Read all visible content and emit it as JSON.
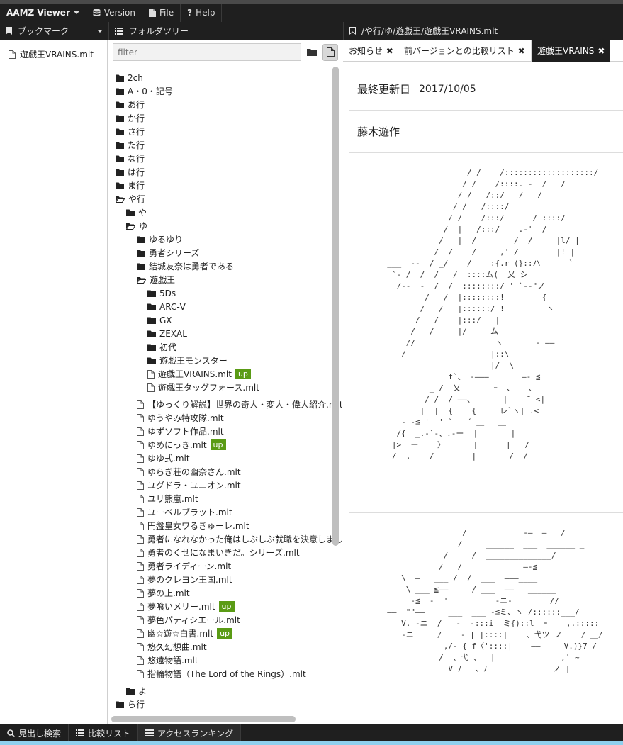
{
  "topbar": {
    "brand": "AAMZ Viewer",
    "menus": [
      {
        "label": "Version",
        "icon": "database-icon"
      },
      {
        "label": "File",
        "icon": "file-icon"
      },
      {
        "label": "Help",
        "icon": "question-icon"
      }
    ]
  },
  "bookmarks": {
    "title": "ブックマーク",
    "items": [
      "遊戯王VRAINS.mlt"
    ]
  },
  "folder_tree": {
    "title": "フォルダツリー",
    "filter_placeholder": "filter",
    "rows": [
      {
        "label": "2ch",
        "type": "folder",
        "depth": 0
      },
      {
        "label": "A・0・記号",
        "type": "folder",
        "depth": 0
      },
      {
        "label": "あ行",
        "type": "folder",
        "depth": 0
      },
      {
        "label": "か行",
        "type": "folder",
        "depth": 0
      },
      {
        "label": "さ行",
        "type": "folder",
        "depth": 0
      },
      {
        "label": "た行",
        "type": "folder",
        "depth": 0
      },
      {
        "label": "な行",
        "type": "folder",
        "depth": 0
      },
      {
        "label": "は行",
        "type": "folder",
        "depth": 0
      },
      {
        "label": "ま行",
        "type": "folder",
        "depth": 0
      },
      {
        "label": "や行",
        "type": "folder-open",
        "depth": 0
      },
      {
        "label": "や",
        "type": "folder",
        "depth": 1
      },
      {
        "label": "ゆ",
        "type": "folder-open",
        "depth": 1
      },
      {
        "label": "ゆるゆり",
        "type": "folder",
        "depth": 2
      },
      {
        "label": "勇者シリーズ",
        "type": "folder",
        "depth": 2
      },
      {
        "label": "結城友奈は勇者である",
        "type": "folder",
        "depth": 2
      },
      {
        "label": "遊戯王",
        "type": "folder-open",
        "depth": 2
      },
      {
        "label": "5Ds",
        "type": "folder",
        "depth": 3
      },
      {
        "label": "ARC-Ⅴ",
        "type": "folder",
        "depth": 3
      },
      {
        "label": "GX",
        "type": "folder",
        "depth": 3
      },
      {
        "label": "ZEXAL",
        "type": "folder",
        "depth": 3
      },
      {
        "label": "初代",
        "type": "folder",
        "depth": 3
      },
      {
        "label": "遊戯王モンスター",
        "type": "folder",
        "depth": 3
      },
      {
        "label": "遊戯王VRAINS.mlt",
        "type": "file",
        "depth": 3,
        "up": true
      },
      {
        "label": "遊戯王タッグフォース.mlt",
        "type": "file",
        "depth": 3
      },
      {
        "label": "【ゆっくり解説】世界の奇人・変人・偉人紹介.mlt",
        "type": "file",
        "depth": 2
      },
      {
        "label": "ゆうやみ特攻隊.mlt",
        "type": "file",
        "depth": 2
      },
      {
        "label": "ゆずソフト作品.mlt",
        "type": "file",
        "depth": 2
      },
      {
        "label": "ゆめにっき.mlt",
        "type": "file",
        "depth": 2,
        "up": true
      },
      {
        "label": "ゆゆ式.mlt",
        "type": "file",
        "depth": 2
      },
      {
        "label": "ゆらぎ荘の幽奈さん.mlt",
        "type": "file",
        "depth": 2
      },
      {
        "label": "ユグドラ・ユニオン.mlt",
        "type": "file",
        "depth": 2
      },
      {
        "label": "ユリ熊嵐.mlt",
        "type": "file",
        "depth": 2
      },
      {
        "label": "ユーベルブラット.mlt",
        "type": "file",
        "depth": 2
      },
      {
        "label": "円盤皇女ワるきゅーレ.mlt",
        "type": "file",
        "depth": 2
      },
      {
        "label": "勇者になれなかった俺はしぶしぶ就職を決意しました.mlt",
        "type": "file",
        "depth": 2
      },
      {
        "label": "勇者のくせになまいきだ。シリーズ.mlt",
        "type": "file",
        "depth": 2
      },
      {
        "label": "勇者ライディーン.mlt",
        "type": "file",
        "depth": 2
      },
      {
        "label": "夢のクレヨン王国.mlt",
        "type": "file",
        "depth": 2
      },
      {
        "label": "夢の上.mlt",
        "type": "file",
        "depth": 2
      },
      {
        "label": "夢喰いメリー.mlt",
        "type": "file",
        "depth": 2,
        "up": true
      },
      {
        "label": "夢色パティシエール.mlt",
        "type": "file",
        "depth": 2
      },
      {
        "label": "幽☆遊☆白書.mlt",
        "type": "file",
        "depth": 2,
        "up": true
      },
      {
        "label": "悠久幻想曲.mlt",
        "type": "file",
        "depth": 2
      },
      {
        "label": "悠遠物語.mlt",
        "type": "file",
        "depth": 2
      },
      {
        "label": "指輪物語（The Lord of the Rings）.mlt",
        "type": "file",
        "depth": 2
      },
      {
        "label": "よ",
        "type": "folder",
        "depth": 1
      },
      {
        "label": "ら行",
        "type": "folder",
        "depth": 0
      }
    ],
    "up_label": "up"
  },
  "content": {
    "path": "/や行/ゆ/遊戯王/遊戯王VRAINS.mlt",
    "tabs": [
      {
        "label": "お知らせ",
        "active": false
      },
      {
        "label": "前バージョンとの比較リスト",
        "active": false
      },
      {
        "label": "遊戯王VRAINS",
        "active": true
      }
    ],
    "last_updated_label": "最終更新日",
    "last_updated_value": "2017/10/05",
    "entry_title": "藤木遊作"
  },
  "bottombar": {
    "tabs": [
      {
        "label": "見出し検索",
        "icon": "search-icon",
        "active": false
      },
      {
        "label": "比較リスト",
        "icon": "list-icon",
        "active": false
      },
      {
        "label": "アクセスランキング",
        "icon": "list-icon",
        "active": true
      }
    ]
  },
  "colors": {
    "bar": "#1f1f1f",
    "up_badge": "#5a9b15",
    "accent_bottom": "#8fd0ee"
  }
}
